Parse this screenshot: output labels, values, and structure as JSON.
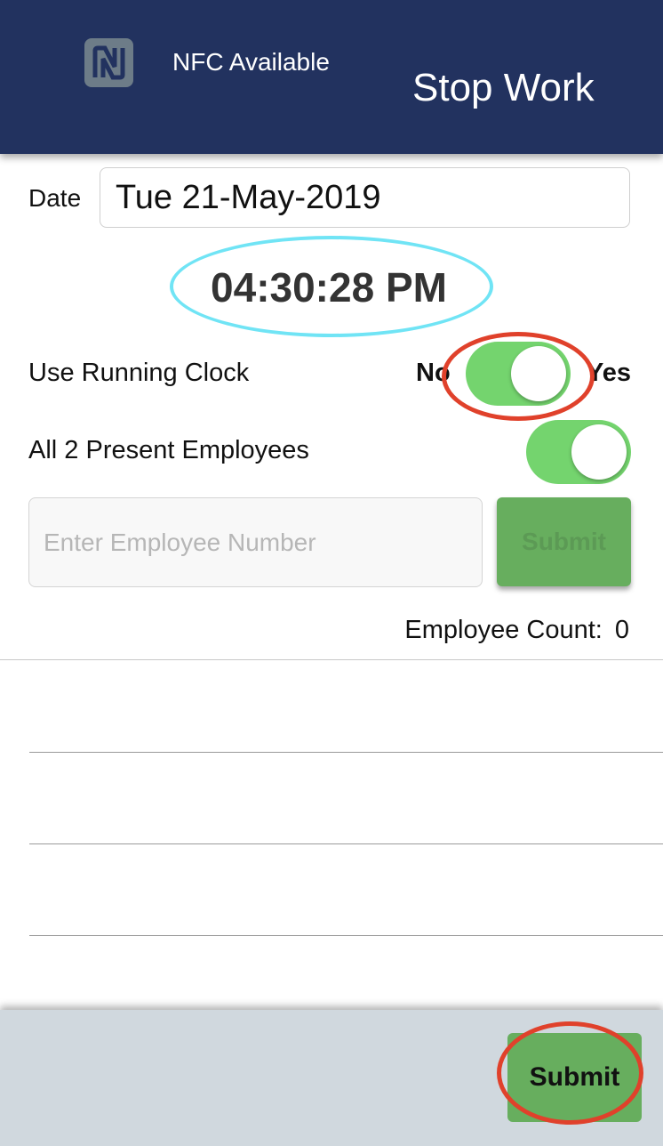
{
  "header": {
    "nfc_status": "NFC Available",
    "title": "Stop Work",
    "background_color": "#22325f"
  },
  "form": {
    "date_label": "Date",
    "date_value": "Tue 21-May-2019",
    "clock": "04:30:28 PM",
    "running_clock_label": "Use Running Clock",
    "no_label": "No",
    "yes_label": "Yes",
    "running_clock_on": true,
    "present_employees_label": "All 2 Present Employees",
    "present_employees_on": true,
    "employee_number_placeholder": "Enter Employee Number",
    "employee_number_value": "",
    "submit_label": "Submit",
    "employee_count_label": "Employee Count:",
    "employee_count_value": "0"
  },
  "footer": {
    "submit_label": "Submit"
  },
  "colors": {
    "toggle_on": "#74d46e",
    "button_green": "#67ae5e",
    "annotation_red": "#e0412b",
    "annotation_cyan": "#70e4f5"
  }
}
